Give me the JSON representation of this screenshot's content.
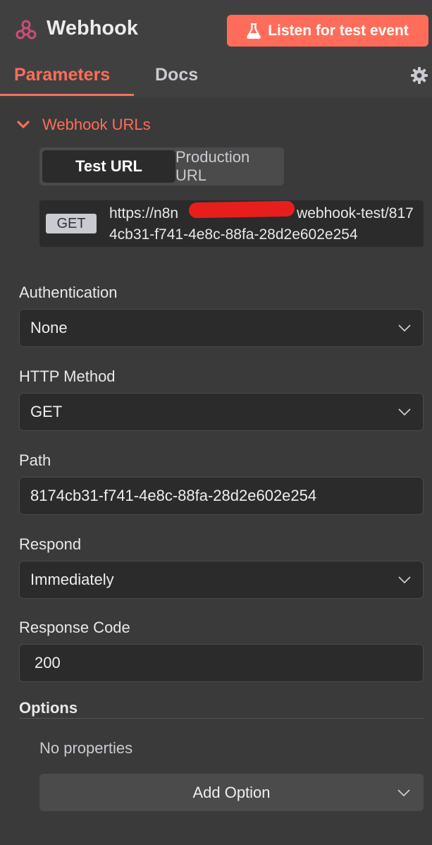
{
  "header": {
    "title": "Webhook",
    "listen_button": "Listen for test event"
  },
  "tabs": [
    {
      "label": "Parameters",
      "active": true
    },
    {
      "label": "Docs",
      "active": false
    }
  ],
  "webhook_urls": {
    "section_label": "Webhook URLs",
    "switch": [
      "Test URL",
      "Production URL"
    ],
    "selected": "Test URL",
    "method": "GET",
    "url": "https://n8n        webhook-test/8174cb31-f741-4e8c-88fa-28d2e602e254"
  },
  "fields": {
    "authentication": {
      "label": "Authentication",
      "value": "None"
    },
    "http_method": {
      "label": "HTTP Method",
      "value": "GET"
    },
    "path": {
      "label": "Path",
      "value": "8174cb31-f741-4e8c-88fa-28d2e602e254"
    },
    "respond": {
      "label": "Respond",
      "value": "Immediately"
    },
    "response_code": {
      "label": "Response Code",
      "value": "200"
    }
  },
  "options": {
    "label": "Options",
    "empty_text": "No properties",
    "add_button": "Add Option"
  },
  "colors": {
    "accent": "#ff6d5a",
    "background": "#404040",
    "input_bg": "#2b2b2b"
  },
  "icons": {
    "logo": "webhook-logo-icon",
    "listen": "flask-icon",
    "settings": "gear-icon",
    "collapse": "chevron-down-icon",
    "dropdown": "chevron-down-icon"
  }
}
